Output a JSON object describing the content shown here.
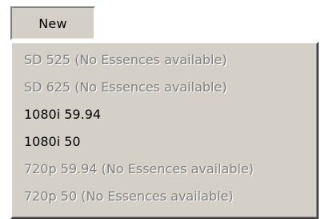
{
  "toolbar": {
    "new_label": "New"
  },
  "menu": {
    "items": [
      {
        "label": "SD 525 (No Essences available)",
        "enabled": false
      },
      {
        "label": "SD 625 (No Essences available)",
        "enabled": false
      },
      {
        "label": "1080i 59.94",
        "enabled": true
      },
      {
        "label": "1080i 50",
        "enabled": true
      },
      {
        "label": "720p 59.94 (No Essences available)",
        "enabled": false
      },
      {
        "label": "720p 50 (No Essences available)",
        "enabled": false
      }
    ]
  },
  "colors": {
    "menu_background": "#d4d0c8",
    "disabled_text": "#808080",
    "enabled_text": "#000000"
  }
}
